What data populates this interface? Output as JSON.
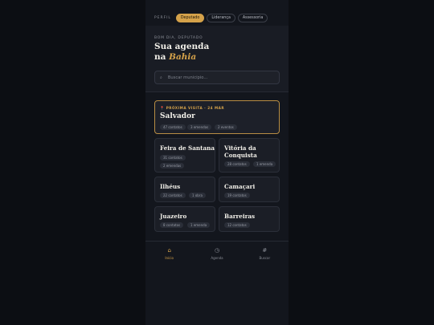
{
  "topbar": {
    "profile_label": "PERFIL",
    "roles": [
      "Deputado",
      "Liderança",
      "Assessoria"
    ],
    "active_role": "Deputado"
  },
  "header": {
    "greeting": "BOM DIA, DEPUTADO",
    "title_line1": "Sua agenda",
    "title_prefix": "na",
    "title_accent": "Bahia"
  },
  "search": {
    "placeholder": "Buscar município...",
    "value": ""
  },
  "featured": {
    "label": "PRÓXIMA VISITA · 24 MAR",
    "pin_icon": "pin-icon",
    "city": "Salvador",
    "chips": [
      "47 contatos",
      "3 emendas",
      "2 eventos"
    ]
  },
  "cities": [
    {
      "name_lines": [
        "Feira de Santana"
      ],
      "chips": [
        "31 contatos",
        "2 emendas"
      ]
    },
    {
      "name_lines": [
        "Vitória da",
        "Conquista"
      ],
      "chips": [
        "28 contatos",
        "1 emenda"
      ]
    },
    {
      "name_lines": [
        "Ilhéus"
      ],
      "chips": [
        "22 contatos",
        "1 obra"
      ]
    },
    {
      "name_lines": [
        "Camaçari"
      ],
      "chips": [
        "19 contatos"
      ]
    },
    {
      "name_lines": [
        "Juazeiro"
      ],
      "chips": [
        "8 contatos",
        "1 emenda"
      ]
    },
    {
      "name_lines": [
        "Barreiras"
      ],
      "chips": [
        "12 contatos"
      ]
    }
  ],
  "nav": [
    {
      "label": "Início",
      "icon": "home-icon",
      "glyph": "⌂",
      "active": true
    },
    {
      "label": "Agenda",
      "icon": "clock-icon",
      "glyph": "◷",
      "active": false
    },
    {
      "label": "Buscar",
      "icon": "hash-icon",
      "glyph": "#",
      "active": false
    }
  ],
  "colors": {
    "accent": "#d5a24a",
    "background": "#13161d"
  }
}
